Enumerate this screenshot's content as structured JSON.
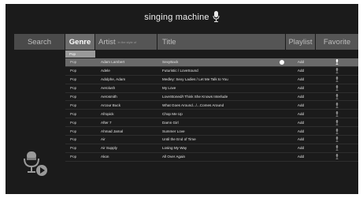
{
  "app": {
    "title": "singing machine"
  },
  "tabs": {
    "search": "Search",
    "genre": "Genre",
    "artist": "Artist",
    "artist_sub": "in the style of",
    "title": "Title",
    "playlist": "Playlist",
    "favorite": "Favorite"
  },
  "genre_filter": {
    "selected": "Pop"
  },
  "songs": [
    {
      "genre": "Pop",
      "artist": "Adam Lambert",
      "title": "SexyBack",
      "playlist": "Add",
      "highlighted": true
    },
    {
      "genre": "Pop",
      "artist": "Adele",
      "title": "Futuristic / LoveSound",
      "playlist": "Add"
    },
    {
      "genre": "Pop",
      "artist": "Adolphe, Adam",
      "title": "Medley: Sexy Ladies / Let Me Talk to You",
      "playlist": "Add"
    },
    {
      "genre": "Pop",
      "artist": "Aerolush",
      "title": "My Love",
      "playlist": "Add"
    },
    {
      "genre": "Pop",
      "artist": "Aerosmith",
      "title": "LoveStoned/I Think She Knows Interlude",
      "playlist": "Add"
    },
    {
      "genre": "Pop",
      "artist": "Arcour Buck",
      "title": "What Goes Around.../...Comes Around",
      "playlist": "Add"
    },
    {
      "genre": "Pop",
      "artist": "Afropick",
      "title": "Chop Me Up",
      "playlist": "Add"
    },
    {
      "genre": "Pop",
      "artist": "After 7",
      "title": "Damn Girl",
      "playlist": "Add"
    },
    {
      "genre": "Pop",
      "artist": "Ahmad Jamal",
      "title": "Summer Love",
      "playlist": "Add"
    },
    {
      "genre": "Pop",
      "artist": "Air",
      "title": "Until the End of Time",
      "playlist": "Add"
    },
    {
      "genre": "Pop",
      "artist": "Air Supply",
      "title": "Losing My Way",
      "playlist": "Add"
    },
    {
      "genre": "Pop",
      "artist": "Akon",
      "title": "All Over Again",
      "playlist": "Add"
    }
  ],
  "colors": {
    "background": "#1b1b1b",
    "header": "#555555",
    "active_tab": "#6d6d6d",
    "highlight_row": "#6a6a6a",
    "text": "#e4e4e4"
  },
  "icons": {
    "logo": "microphone-icon",
    "favorite": "microphone-icon",
    "bottom_left": "microphone-play-icon"
  }
}
